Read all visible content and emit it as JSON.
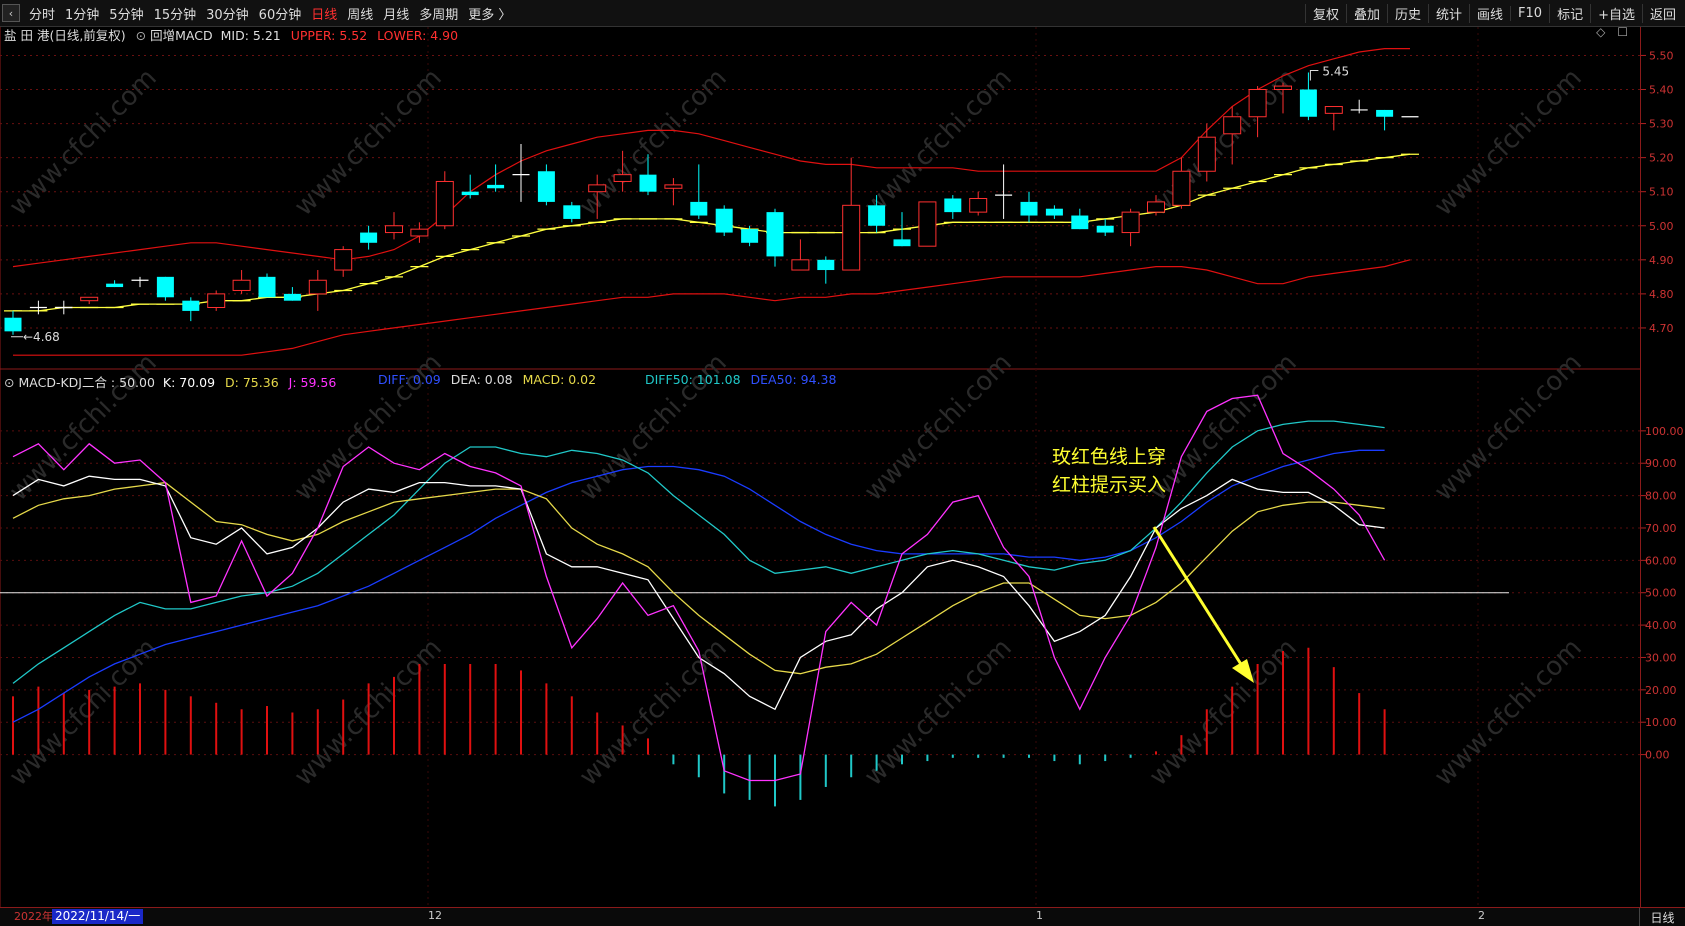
{
  "toolbar": {
    "back_label": "‹",
    "timeframes": [
      "分时",
      "1分钟",
      "5分钟",
      "15分钟",
      "30分钟",
      "60分钟",
      "日线",
      "周线",
      "月线",
      "多周期",
      "更多 〉"
    ],
    "active_timeframe": "日线",
    "right_buttons": [
      "复权",
      "叠加",
      "历史",
      "统计",
      "画线",
      "F10",
      "标记",
      "+自选",
      "返回"
    ]
  },
  "header": {
    "stock": "盐 田 港(日线,前复权)",
    "indicator_name": "回增MACD",
    "mid": "MID: 5.21",
    "upper": "UPPER: 5.52",
    "lower": "LOWER: 4.90"
  },
  "sub_header": {
    "name": "MACD-KDJ二合 : 50.00",
    "k": "K: 70.09",
    "d": "D: 75.36",
    "j": "J: 59.56",
    "diff": "DIFF: 0.09",
    "dea": "DEA: 0.08",
    "macd": "MACD: 0.02",
    "diff50": "DIFF50: 101.08",
    "dea50": "DEA50: 94.38"
  },
  "annotation": {
    "line1": "玫红色线上穿",
    "line2": "红柱提示买入"
  },
  "price_labels": {
    "high": "5.45",
    "low": "4.68"
  },
  "watermark": "www.cfchi.com",
  "bottom": {
    "year": "2022年",
    "cursor_date": "2022/11/14/一",
    "months": [
      "12",
      "1",
      "2"
    ],
    "period_button": "日线"
  },
  "colors": {
    "up": "#ff3030",
    "down": "#00ffff",
    "band": "#e01010",
    "mid": "#ffff40",
    "k": "#ffffff",
    "d": "#e6d94a",
    "j": "#ff33ff",
    "diff50": "#20c8c8",
    "dea50": "#1a3cff"
  },
  "chart_data": [
    {
      "type": "candlestick",
      "title": "盐 田 港(日线,前复权)",
      "ylim": [
        4.6,
        5.56
      ],
      "y_ticks": [
        4.7,
        4.8,
        4.9,
        5.0,
        5.1,
        5.2,
        5.3,
        5.4,
        5.5
      ],
      "candles": [
        {
          "o": 4.73,
          "h": 4.75,
          "l": 4.68,
          "c": 4.69
        },
        {
          "o": 4.76,
          "h": 4.78,
          "l": 4.74,
          "c": 4.76
        },
        {
          "o": 4.76,
          "h": 4.78,
          "l": 4.74,
          "c": 4.76
        },
        {
          "o": 4.78,
          "h": 4.79,
          "l": 4.77,
          "c": 4.79
        },
        {
          "o": 4.83,
          "h": 4.84,
          "l": 4.82,
          "c": 4.82
        },
        {
          "o": 4.84,
          "h": 4.85,
          "l": 4.82,
          "c": 4.84
        },
        {
          "o": 4.85,
          "h": 4.85,
          "l": 4.78,
          "c": 4.79
        },
        {
          "o": 4.78,
          "h": 4.79,
          "l": 4.72,
          "c": 4.75
        },
        {
          "o": 4.76,
          "h": 4.81,
          "l": 4.75,
          "c": 4.8
        },
        {
          "o": 4.81,
          "h": 4.87,
          "l": 4.8,
          "c": 4.84
        },
        {
          "o": 4.85,
          "h": 4.86,
          "l": 4.8,
          "c": 4.79
        },
        {
          "o": 4.8,
          "h": 4.82,
          "l": 4.78,
          "c": 4.78
        },
        {
          "o": 4.8,
          "h": 4.87,
          "l": 4.75,
          "c": 4.84
        },
        {
          "o": 4.87,
          "h": 4.94,
          "l": 4.85,
          "c": 4.93
        },
        {
          "o": 4.98,
          "h": 5.0,
          "l": 4.93,
          "c": 4.95
        },
        {
          "o": 4.98,
          "h": 5.04,
          "l": 4.96,
          "c": 5.0
        },
        {
          "o": 4.97,
          "h": 5.01,
          "l": 4.95,
          "c": 4.99
        },
        {
          "o": 5.0,
          "h": 5.16,
          "l": 4.99,
          "c": 5.13
        },
        {
          "o": 5.1,
          "h": 5.15,
          "l": 5.08,
          "c": 5.09
        },
        {
          "o": 5.12,
          "h": 5.18,
          "l": 5.1,
          "c": 5.11
        },
        {
          "o": 5.15,
          "h": 5.24,
          "l": 5.07,
          "c": 5.15
        },
        {
          "o": 5.16,
          "h": 5.18,
          "l": 5.06,
          "c": 5.07
        },
        {
          "o": 5.06,
          "h": 5.07,
          "l": 5.01,
          "c": 5.02
        },
        {
          "o": 5.1,
          "h": 5.15,
          "l": 5.02,
          "c": 5.12
        },
        {
          "o": 5.13,
          "h": 5.22,
          "l": 5.1,
          "c": 5.15
        },
        {
          "o": 5.15,
          "h": 5.21,
          "l": 5.09,
          "c": 5.1
        },
        {
          "o": 5.11,
          "h": 5.14,
          "l": 5.06,
          "c": 5.12
        },
        {
          "o": 5.07,
          "h": 5.18,
          "l": 5.02,
          "c": 5.03
        },
        {
          "o": 5.05,
          "h": 5.06,
          "l": 4.97,
          "c": 4.98
        },
        {
          "o": 4.99,
          "h": 5.0,
          "l": 4.94,
          "c": 4.95
        },
        {
          "o": 5.04,
          "h": 5.05,
          "l": 4.88,
          "c": 4.91
        },
        {
          "o": 4.87,
          "h": 4.96,
          "l": 4.87,
          "c": 4.9
        },
        {
          "o": 4.9,
          "h": 4.91,
          "l": 4.83,
          "c": 4.87
        },
        {
          "o": 4.87,
          "h": 5.2,
          "l": 4.87,
          "c": 5.06
        },
        {
          "o": 5.06,
          "h": 5.09,
          "l": 4.98,
          "c": 5.0
        },
        {
          "o": 4.96,
          "h": 5.04,
          "l": 4.94,
          "c": 4.94
        },
        {
          "o": 4.94,
          "h": 5.07,
          "l": 4.94,
          "c": 5.07
        },
        {
          "o": 5.08,
          "h": 5.09,
          "l": 5.02,
          "c": 5.04
        },
        {
          "o": 5.04,
          "h": 5.1,
          "l": 5.03,
          "c": 5.08
        },
        {
          "o": 5.09,
          "h": 5.18,
          "l": 5.02,
          "c": 5.09
        },
        {
          "o": 5.07,
          "h": 5.1,
          "l": 5.01,
          "c": 5.03
        },
        {
          "o": 5.05,
          "h": 5.06,
          "l": 5.02,
          "c": 5.03
        },
        {
          "o": 5.03,
          "h": 5.05,
          "l": 4.99,
          "c": 4.99
        },
        {
          "o": 5.0,
          "h": 5.02,
          "l": 4.97,
          "c": 4.98
        },
        {
          "o": 4.98,
          "h": 5.05,
          "l": 4.94,
          "c": 5.04
        },
        {
          "o": 5.04,
          "h": 5.09,
          "l": 5.03,
          "c": 5.07
        },
        {
          "o": 5.06,
          "h": 5.2,
          "l": 5.05,
          "c": 5.16
        },
        {
          "o": 5.16,
          "h": 5.3,
          "l": 5.13,
          "c": 5.26
        },
        {
          "o": 5.27,
          "h": 5.35,
          "l": 5.18,
          "c": 5.32
        },
        {
          "o": 5.32,
          "h": 5.41,
          "l": 5.26,
          "c": 5.4
        },
        {
          "o": 5.4,
          "h": 5.42,
          "l": 5.33,
          "c": 5.41
        },
        {
          "o": 5.4,
          "h": 5.45,
          "l": 5.31,
          "c": 5.32
        },
        {
          "o": 5.33,
          "h": 5.35,
          "l": 5.28,
          "c": 5.35
        },
        {
          "o": 5.34,
          "h": 5.37,
          "l": 5.33,
          "c": 5.34
        },
        {
          "o": 5.34,
          "h": 5.34,
          "l": 5.28,
          "c": 5.32
        },
        {
          "o": 5.32,
          "h": 5.32,
          "l": 5.32,
          "c": 5.32
        }
      ],
      "series": [
        {
          "name": "UPPER",
          "values": [
            4.88,
            4.89,
            4.9,
            4.91,
            4.92,
            4.93,
            4.94,
            4.95,
            4.95,
            4.94,
            4.93,
            4.92,
            4.91,
            4.9,
            4.91,
            4.93,
            4.97,
            5.03,
            5.1,
            5.15,
            5.19,
            5.22,
            5.24,
            5.26,
            5.27,
            5.28,
            5.28,
            5.27,
            5.25,
            5.23,
            5.21,
            5.19,
            5.18,
            5.18,
            5.17,
            5.17,
            5.17,
            5.17,
            5.16,
            5.16,
            5.16,
            5.16,
            5.16,
            5.16,
            5.16,
            5.16,
            5.2,
            5.28,
            5.35,
            5.4,
            5.44,
            5.47,
            5.49,
            5.51,
            5.52,
            5.52
          ]
        },
        {
          "name": "MID",
          "values": [
            4.75,
            4.75,
            4.76,
            4.76,
            4.76,
            4.77,
            4.77,
            4.77,
            4.78,
            4.78,
            4.79,
            4.79,
            4.8,
            4.81,
            4.83,
            4.85,
            4.88,
            4.91,
            4.93,
            4.95,
            4.97,
            4.99,
            5.0,
            5.01,
            5.02,
            5.02,
            5.02,
            5.01,
            5.0,
            4.99,
            4.98,
            4.98,
            4.98,
            4.98,
            4.98,
            4.99,
            5.0,
            5.01,
            5.01,
            5.01,
            5.01,
            5.01,
            5.01,
            5.02,
            5.03,
            5.04,
            5.06,
            5.09,
            5.11,
            5.13,
            5.15,
            5.17,
            5.18,
            5.19,
            5.2,
            5.21
          ]
        },
        {
          "name": "LOWER",
          "values": [
            4.62,
            4.62,
            4.62,
            4.62,
            4.62,
            4.62,
            4.62,
            4.62,
            4.62,
            4.62,
            4.63,
            4.64,
            4.66,
            4.68,
            4.69,
            4.7,
            4.71,
            4.72,
            4.73,
            4.74,
            4.75,
            4.76,
            4.77,
            4.78,
            4.79,
            4.79,
            4.8,
            4.8,
            4.8,
            4.79,
            4.78,
            4.79,
            4.79,
            4.8,
            4.8,
            4.81,
            4.82,
            4.83,
            4.84,
            4.85,
            4.85,
            4.85,
            4.85,
            4.86,
            4.87,
            4.88,
            4.88,
            4.87,
            4.85,
            4.83,
            4.83,
            4.85,
            4.86,
            4.87,
            4.88,
            4.9
          ]
        }
      ]
    },
    {
      "type": "line",
      "title": "MACD-KDJ二合",
      "ylim": [
        -27,
        112
      ],
      "y_ticks": [
        0,
        10,
        20,
        30,
        40,
        50,
        60,
        70,
        80,
        90,
        100
      ],
      "reference_line": 50,
      "series": [
        {
          "name": "J",
          "values": [
            92,
            96,
            88,
            96,
            90,
            91,
            84,
            47,
            49,
            66,
            49,
            56,
            70,
            89,
            95,
            90,
            88,
            93,
            89,
            87,
            83,
            55,
            33,
            42,
            53,
            43,
            46,
            32,
            -5,
            -8,
            -8,
            -6,
            38,
            47,
            40,
            62,
            68,
            78,
            80,
            64,
            55,
            30,
            14,
            30,
            43,
            64,
            92,
            106,
            110,
            111,
            93,
            88,
            82,
            74,
            60
          ]
        },
        {
          "name": "K",
          "values": [
            80,
            85,
            83,
            86,
            85,
            85,
            83,
            67,
            65,
            70,
            62,
            64,
            70,
            78,
            82,
            81,
            84,
            84,
            83,
            83,
            82,
            62,
            58,
            58,
            56,
            54,
            42,
            30,
            25,
            18,
            14,
            30,
            35,
            37,
            45,
            50,
            58,
            60,
            58,
            55,
            46,
            35,
            38,
            43,
            55,
            70,
            76,
            80,
            85,
            82,
            81,
            81,
            77,
            71,
            70
          ]
        },
        {
          "name": "D",
          "values": [
            73,
            77,
            79,
            80,
            82,
            83,
            84,
            78,
            72,
            71,
            68,
            66,
            68,
            72,
            75,
            78,
            79,
            80,
            81,
            82,
            82,
            79,
            70,
            65,
            62,
            58,
            50,
            43,
            37,
            31,
            26,
            25,
            27,
            28,
            31,
            36,
            41,
            46,
            50,
            53,
            53,
            48,
            43,
            42,
            43,
            47,
            53,
            61,
            69,
            75,
            77,
            78,
            78,
            77,
            76
          ]
        },
        {
          "name": "DIFF50",
          "values": [
            22,
            28,
            33,
            38,
            43,
            47,
            45,
            45,
            47,
            49,
            50,
            52,
            56,
            62,
            68,
            74,
            82,
            90,
            95,
            95,
            93,
            92,
            94,
            93,
            91,
            87,
            80,
            74,
            68,
            60,
            56,
            57,
            58,
            56,
            58,
            60,
            62,
            63,
            62,
            60,
            58,
            57,
            59,
            60,
            63,
            70,
            78,
            87,
            95,
            100,
            102,
            103,
            103,
            102,
            101
          ]
        },
        {
          "name": "DEA50",
          "values": [
            10,
            14,
            19,
            24,
            28,
            31,
            34,
            36,
            38,
            40,
            42,
            44,
            46,
            49,
            52,
            56,
            60,
            64,
            68,
            73,
            77,
            81,
            84,
            86,
            88,
            89,
            89,
            88,
            86,
            82,
            77,
            72,
            68,
            65,
            63,
            62,
            62,
            62,
            62,
            62,
            61,
            61,
            60,
            61,
            63,
            67,
            72,
            78,
            83,
            86,
            89,
            91,
            93,
            94,
            94
          ]
        },
        {
          "name": "MACD",
          "values": [
            18,
            21,
            19,
            20,
            21,
            22,
            20,
            18,
            16,
            14,
            15,
            13,
            14,
            17,
            22,
            24,
            28,
            28,
            28,
            28,
            26,
            22,
            18,
            13,
            9,
            5,
            -3,
            -7,
            -12,
            -14,
            -16,
            -14,
            -10,
            -7,
            -5,
            -3,
            -2,
            -1,
            -1,
            -1,
            -1,
            -2,
            -3,
            -2,
            -1,
            1,
            6,
            14,
            21,
            28,
            32,
            33,
            27,
            19,
            14
          ]
        }
      ]
    }
  ]
}
